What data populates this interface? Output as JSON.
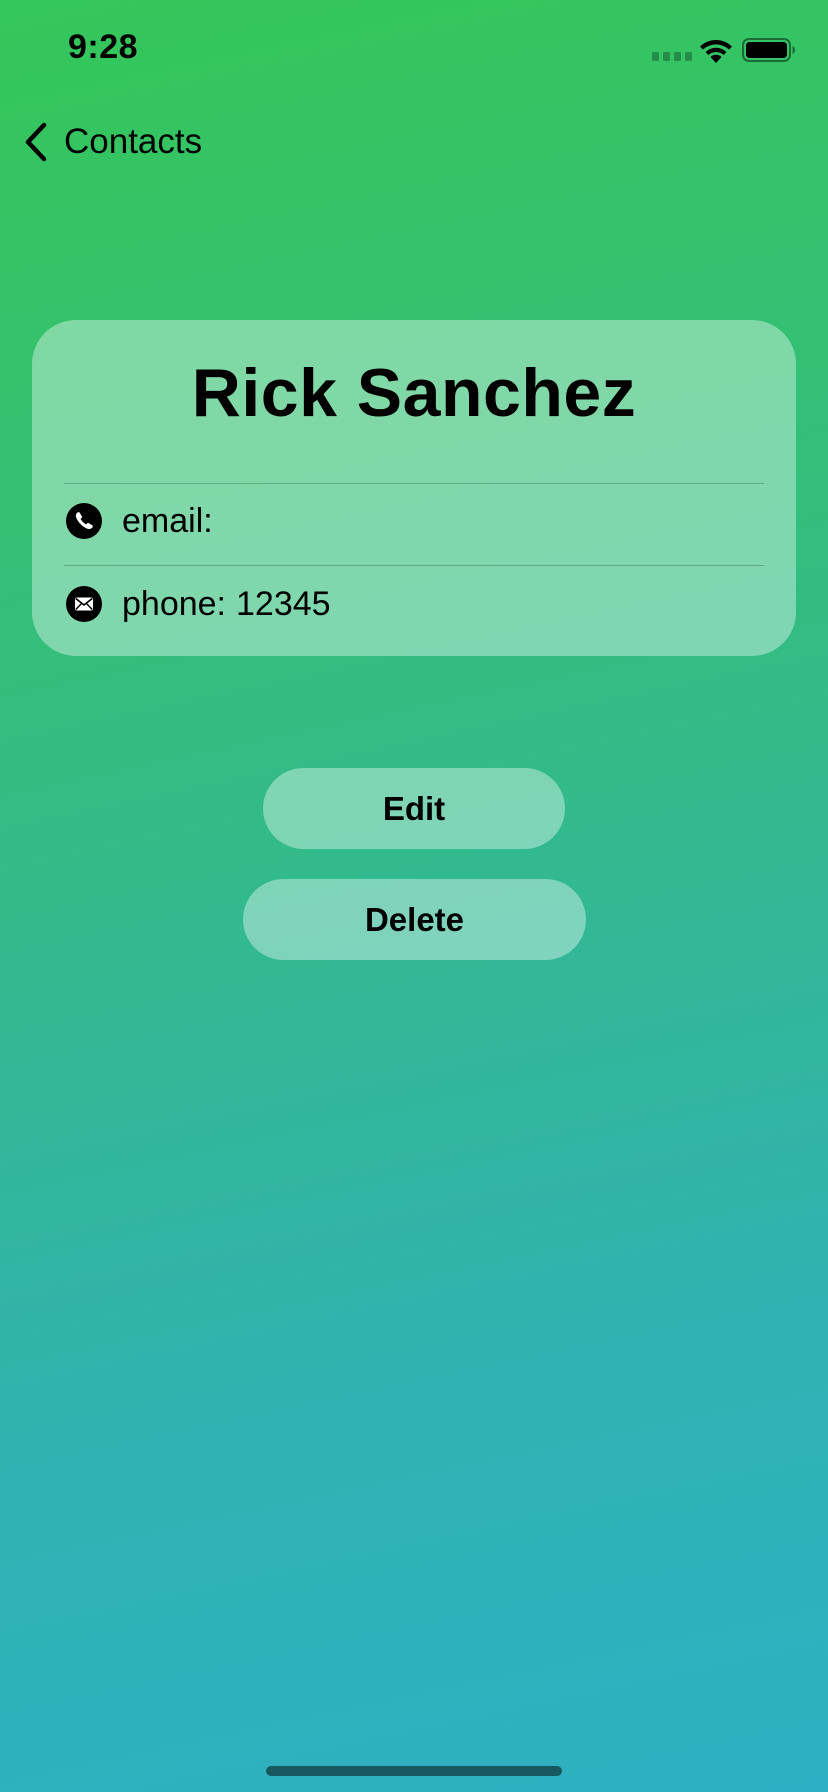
{
  "status_bar": {
    "time": "9:28"
  },
  "nav": {
    "back_label": "Contacts"
  },
  "contact": {
    "name": "Rick Sanchez",
    "rows": [
      {
        "icon": "phone-icon",
        "label": "email:",
        "value": ""
      },
      {
        "icon": "envelope-icon",
        "label": "phone:",
        "value": "12345"
      }
    ]
  },
  "actions": {
    "edit_label": "Edit",
    "delete_label": "Delete"
  },
  "colors": {
    "gradient_top": "#34c759",
    "gradient_bottom": "#2eb0c4",
    "card_fill": "rgba(255,255,255,0.38)"
  }
}
